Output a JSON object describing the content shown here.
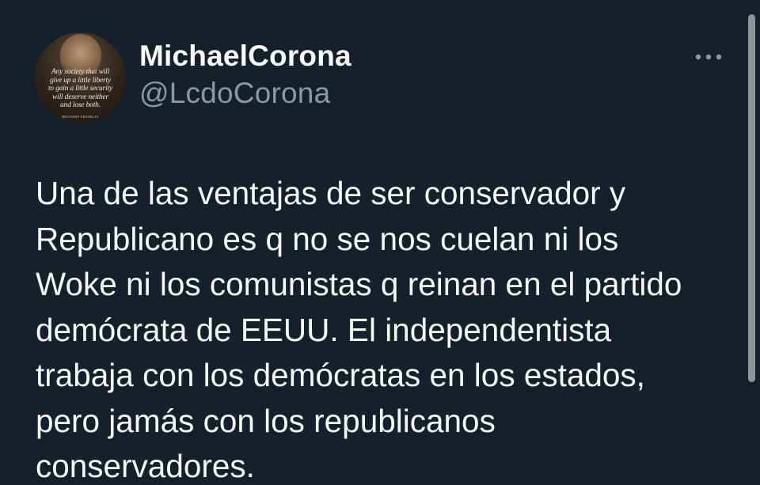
{
  "author": {
    "display_name": "MichaelCorona",
    "handle": "@LcdoCorona",
    "avatar_quote_lines": [
      "Any society that will",
      "give up a little liberty",
      "to gain a little security",
      "will deserve neither",
      "and lose both."
    ],
    "avatar_signature": "BENJAMIN FRANKLIN"
  },
  "tweet": {
    "text": "Una de las ventajas de ser conservador y\nRepublicano es q no se nos cuelan ni los\nWoke ni los comunistas q reinan en el partido\ndemócrata de EEUU. El independentista\ntrabaja con los demócratas en los estados,\npero jamás con los republicanos\nconservadores."
  },
  "icons": {
    "more": "more-horizontal-icon"
  },
  "colors": {
    "background": "#15202b",
    "text_primary": "#f7f9f9",
    "text_secondary": "#8b98a5",
    "scrollbar": "#8e9499"
  }
}
